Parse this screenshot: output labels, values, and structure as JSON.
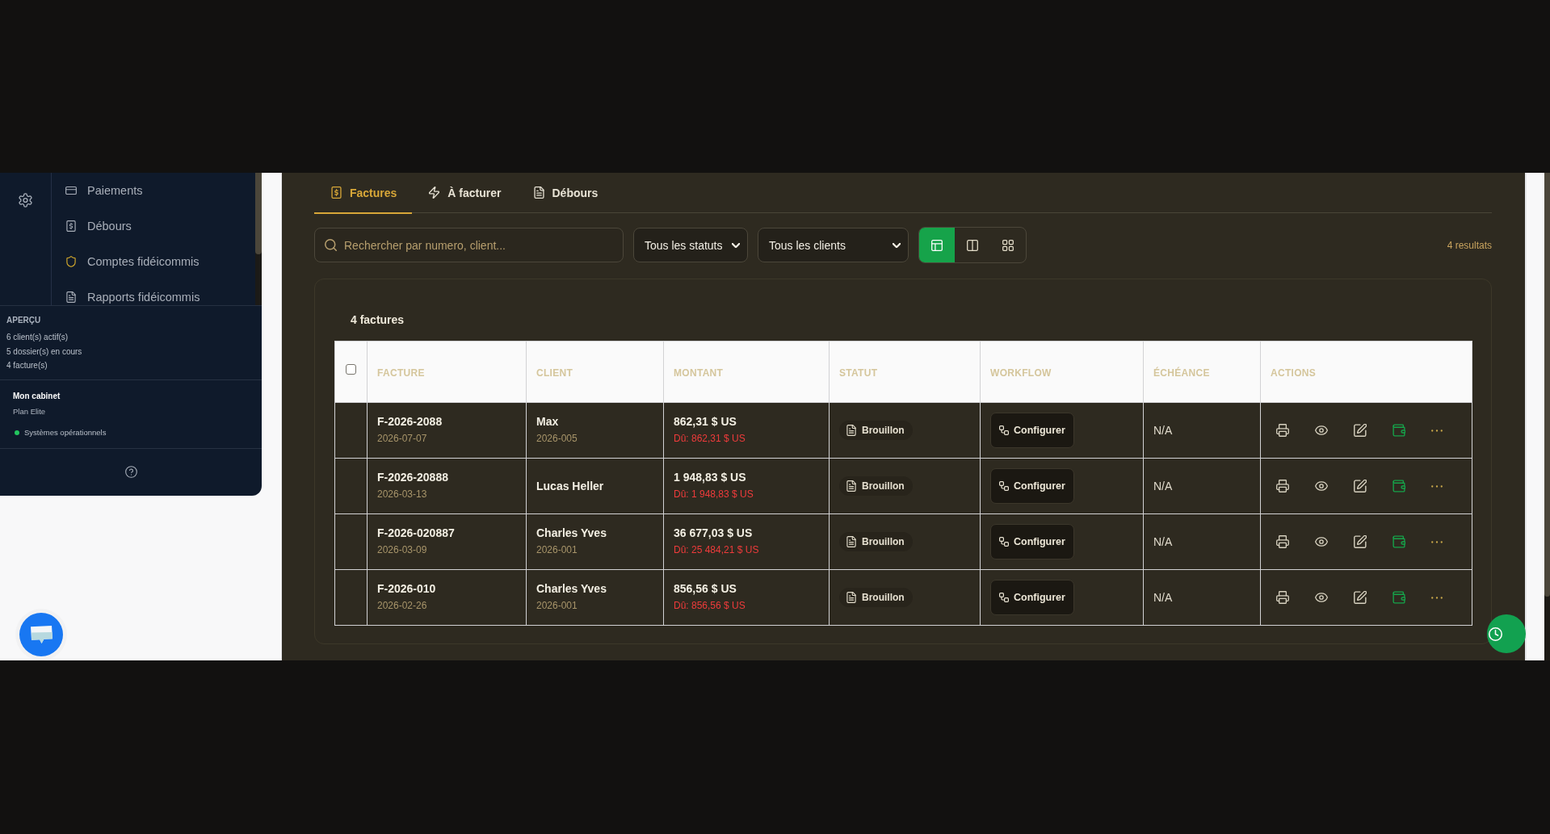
{
  "sidebar": {
    "nav_items": [
      {
        "label": "Paiements",
        "selected": false
      },
      {
        "label": "Débours",
        "selected": false
      },
      {
        "label": "Comptes fidéicommis",
        "selected": false
      },
      {
        "label": "Rapports fidéicommis",
        "selected": false
      }
    ],
    "overview": {
      "title": "APERÇU",
      "lines": [
        "6 client(s) actif(s)",
        "5 dossier(s) en cours",
        "4 facture(s)"
      ]
    },
    "firm": {
      "name": "Mon cabinet",
      "plan": "Plan Elite",
      "status": {
        "label": "Systèmes opérationnels",
        "operational": true
      }
    }
  },
  "tabs": [
    {
      "label": "Factures",
      "selected": true
    },
    {
      "label": "À facturer",
      "selected": false
    },
    {
      "label": "Débours",
      "selected": false
    }
  ],
  "filters": {
    "search": {
      "placeholder": "Rechercher par numero, client..."
    },
    "selects": [
      {
        "value": "Tous les statuts"
      },
      {
        "value": "Tous les clients"
      }
    ],
    "view_modes": [
      {
        "selected": true
      },
      {
        "selected": false
      },
      {
        "selected": false
      }
    ],
    "result_count": "4 resultats"
  },
  "invoices": {
    "title": "4 factures",
    "select_all": {
      "checked": false
    },
    "columns": [
      "FACTURE",
      "CLIENT",
      "MONTANT",
      "STATUT",
      "WORKFLOW",
      "ÉCHÉANCE",
      "ACTIONS"
    ],
    "rows": [
      {
        "number": "F-2026-2088",
        "date": "2026-07-07",
        "client": "Max",
        "client_code": "2026-005",
        "amount": "862,31 $ US",
        "due": "Dû: 862,31 $ US",
        "status": "Brouillon",
        "workflow": "Configurer",
        "due_date": "N/A"
      },
      {
        "number": "F-2026-20888",
        "date": "2026-03-13",
        "client": "Lucas Heller",
        "amount": "1 948,83 $ US",
        "due": "Dû: 1 948,83 $ US",
        "status": "Brouillon",
        "workflow": "Configurer",
        "due_date": "N/A"
      },
      {
        "number": "F-2026-020887",
        "date": "2026-03-09",
        "client": "Charles Yves",
        "client_code": "2026-001",
        "amount": "36 677,03 $ US",
        "due": "Dû: 25 484,21 $ US",
        "status": "Brouillon",
        "workflow": "Configurer",
        "due_date": "N/A"
      },
      {
        "number": "F-2026-010",
        "date": "2026-02-26",
        "client": "Charles Yves",
        "client_code": "2026-001",
        "amount": "856,56 $ US",
        "due": "Dû: 856,56 $ US",
        "status": "Brouillon",
        "workflow": "Configurer",
        "due_date": "N/A"
      }
    ]
  }
}
